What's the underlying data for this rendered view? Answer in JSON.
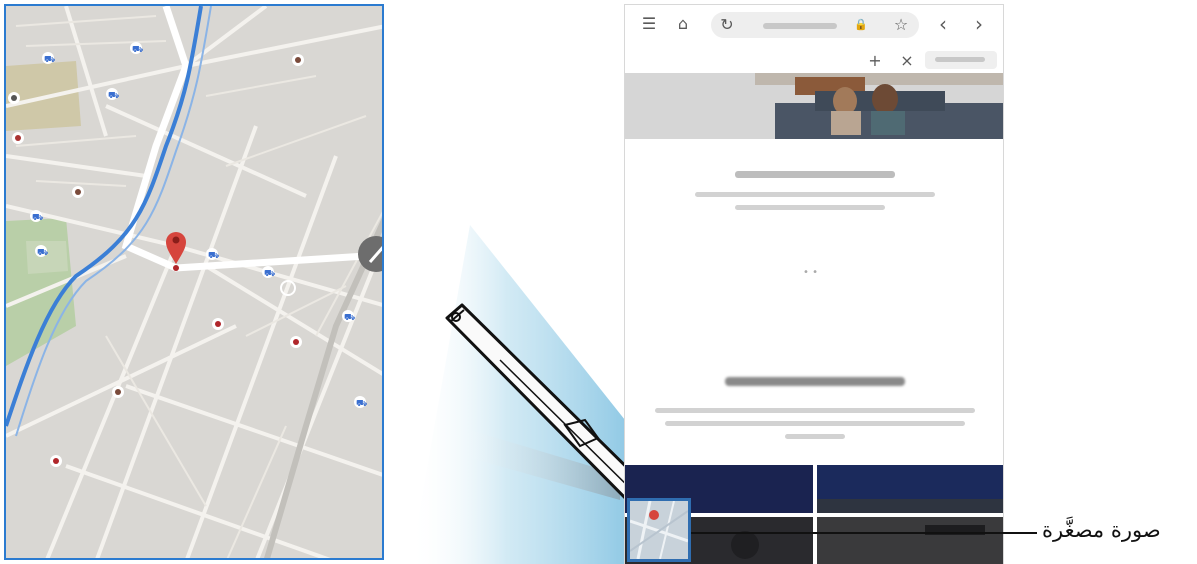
{
  "thumbnail_label": "صورة مصغَّرة",
  "colors": {
    "frame_border": "#2b7bd0",
    "map_background": "#d9d7d3",
    "river": "#3b7fd6",
    "pin": "#d6453d",
    "thumb_border": "#2f6db0"
  },
  "browser": {
    "menu_icon": "☰",
    "home_icon": "⌂",
    "reload_icon": "↻",
    "lock_icon": "🔒",
    "star_icon": "☆",
    "back_icon": "‹",
    "forward_icon": "›",
    "new_tab_icon": "+",
    "close_tab_icon": "×",
    "dots_text": "• •"
  },
  "icons": {
    "map_panel": "map-view",
    "pen": "s-pen-icon",
    "pin": "map-pin-icon"
  }
}
